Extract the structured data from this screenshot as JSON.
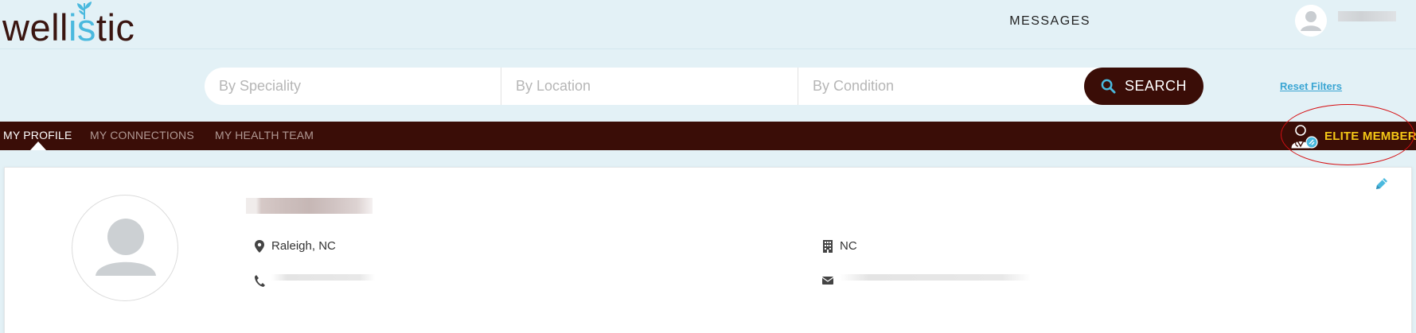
{
  "brand": {
    "logo_pre": "well",
    "logo_accent": "is",
    "logo_post": "tic",
    "accent_color": "#4ab9de",
    "dark_color": "#3a0d07"
  },
  "header": {
    "messages_label": "MESSAGES",
    "user_icon": "user-avatar-icon"
  },
  "search": {
    "speciality_placeholder": "By Speciality",
    "location_placeholder": "By Location",
    "condition_placeholder": "By Condition",
    "search_label": "SEARCH",
    "search_icon": "search-icon",
    "reset_label": "Reset Filters"
  },
  "nav": {
    "tabs": [
      {
        "label": "MY PROFILE",
        "active": true
      },
      {
        "label": "MY CONNECTIONS",
        "active": false
      },
      {
        "label": "MY HEALTH TEAM",
        "active": false
      }
    ],
    "elite_label": "ELITE MEMBER",
    "elite_color": "#f5c816",
    "elite_icon": "doctor-badge-icon"
  },
  "profile": {
    "location": "Raleigh, NC",
    "state": "NC",
    "icons": {
      "location": "map-pin-icon",
      "organization": "building-icon",
      "phone": "phone-icon",
      "email": "envelope-icon",
      "edit": "pencil-icon"
    }
  }
}
